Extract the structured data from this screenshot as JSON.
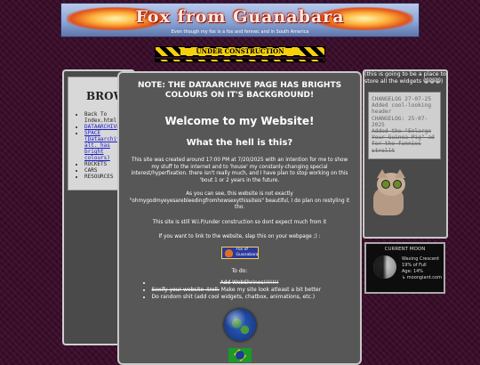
{
  "banner": {
    "title": "Fox from Guanabara",
    "subtitle": "Even though my fox is a fox and fennec and in South America"
  },
  "under_construction": {
    "label": "UNDER CONSTRUCTION"
  },
  "sidebar": {
    "heading": "BROWSE",
    "items": [
      {
        "label": "Back To Index.html"
      },
      {
        "label": "DATAARCHIVE"
      },
      {
        "label": "SPACE (Dataarchive alt. has bright colours)"
      },
      {
        "label": "ROCKETS"
      },
      {
        "label": "CARS"
      },
      {
        "label": "RESOURCES"
      }
    ]
  },
  "main": {
    "note": "NOTE: THE DATAARCHIVE PAGE HAS BRIGHTS COLOURS ON IT'S BACKGROUND!",
    "welcome": "Welcome to my Website!",
    "subheading": "What the hell is this?",
    "para1": "This site was created around 17:00 PM at 7/20/2025 with an intention for me to show my stuff to the internet and to 'house' my constanly-changing special interest/hyperfixation. there isn't really much, and I have plan to stop working on this 'bout 1 or 2 years in the future.",
    "para2": "As you can see, this website is not exactly \"ohmygodmyeyesarebleedingfromhowsexythissiteis\" beautiful, I do plan on restyling it tho.",
    "para3": "This site is still W.I.P/under construction so dont expect much from it",
    "para4": "If you want to link to the website, slap this on your webpage ;) :",
    "badge": "Fox of Guanabara",
    "todo_label": "To do:",
    "todo": [
      {
        "text": "Add WebShrines!!!!!!!",
        "done": true
      },
      {
        "text_strike": "Sexify your website :troll:",
        "text": " Make my site look atleast a bit better"
      },
      {
        "text": "Do random shit (add cool widgets, chatbox, animations, etc.)"
      }
    ]
  },
  "right": {
    "note": "(this is going to be a place to store all the widgets 😸😸😸)",
    "changelog": [
      {
        "text": "CHANGELOG 27-07-25 Added cool-looking header"
      },
      {
        "text": "CHANGELOG: 25-07-2025"
      },
      {
        "text": "Added the \"Enlarge Your Guinea Pig\" ad for the funnies",
        "strike": true
      },
      {
        "text": "strollt",
        "strike": true
      }
    ],
    "moon": {
      "title": "CURRENT MOON",
      "phase": "Waxing Crescent",
      "full": "19% of Full",
      "age": "Age: 14%",
      "credit": "↳ moongiant.com"
    }
  }
}
